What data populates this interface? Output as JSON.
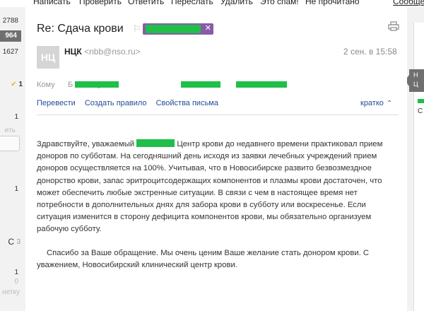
{
  "toolbar": {
    "items": [
      "Написать",
      "Проверить",
      "Ответить",
      "Переслать",
      "Удалить",
      "Это спам!",
      "Не прочитано"
    ],
    "right_item": "Сообщени"
  },
  "left_sidebar": {
    "counts": [
      "2788",
      "964",
      "1627",
      "1",
      "1",
      "ить",
      "1",
      "С",
      "3",
      "1",
      "0",
      "нетку"
    ]
  },
  "message": {
    "subject": "Re: Сдача крови",
    "avatar_text": "НЦ",
    "sender_name": "НЦК",
    "sender_email": "<nbb@nso.ru>",
    "date": "2 сен. в 15:58",
    "to_label": "Кому",
    "to_value": "Б        К          й  <         @          >",
    "actions": [
      "Перевести",
      "Создать правило",
      "Свойства письма"
    ],
    "brief_label": "кратко",
    "body_p1_start": "Здравствуйте, уважаемый",
    "body_p1_rest": " Центр крови до недавнего времени практиковал прием доноров по субботам. На сегодняшний день исходя из заявки лечебных учреждений прием доноров осуществляется на 100%. Учитывая, что в Новосибирске развито безвозмездное донорство крови, запас эритроцитсодержащих компонентов и плазмы крови достаточен, что может обеспечить любые экстренные ситуации. В связи с чем в настоящее время нет потребности в дополнительных днях для забора крови в субботу или воскресенье. Если ситуация изменится в сторону дефицита компонентов крови, мы обязательно организуем рабочую субботу.",
    "body_p2": "Спасибо за Ваше обращение. Мы очень ценим Ваше желание стать донором крови. С уважением, Новосибирский клинический центр крови."
  },
  "right_strip": {
    "tag_lines": [
      "Н",
      "Ц"
    ],
    "side_text": "С"
  },
  "colors": {
    "label_purple": "#8a5aa8",
    "redaction_green": "#1fbf4a",
    "link_blue": "#224c99",
    "selected_gray": "#6f6f6f"
  },
  "icons": [
    "flag-icon",
    "close-icon",
    "print-icon",
    "checkmark-icon",
    "chevron-up-icon"
  ]
}
